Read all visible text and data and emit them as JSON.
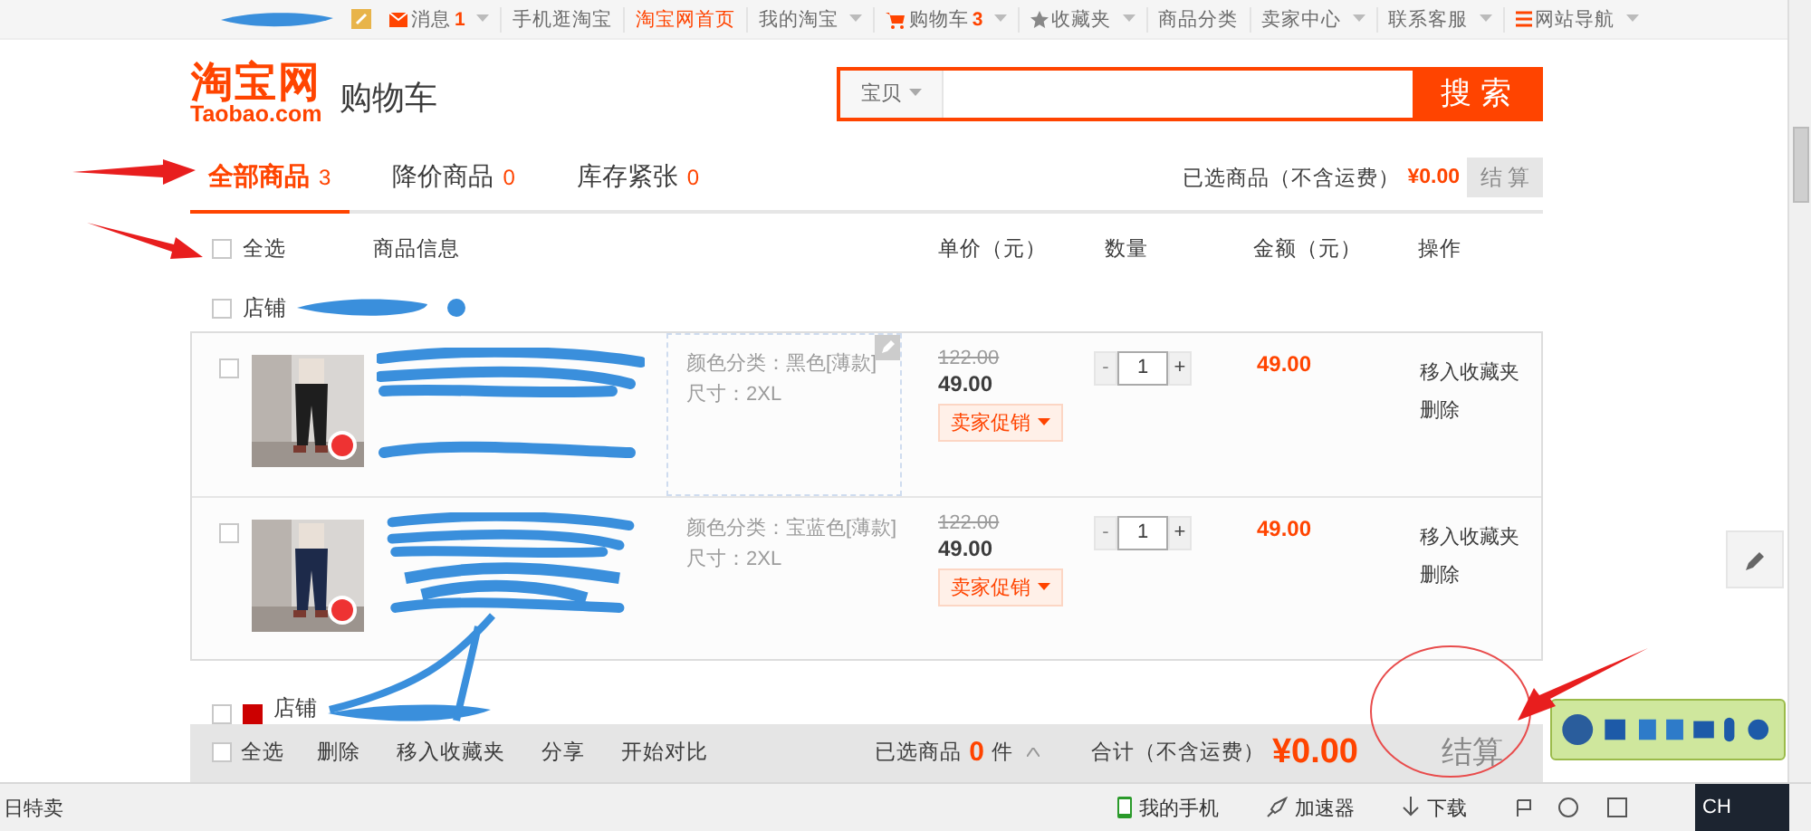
{
  "top_nav": {
    "items": [
      {
        "label": "消息",
        "count": "1",
        "kind": "mail",
        "dropdown": true,
        "active": false
      },
      {
        "label": "手机逛淘宝",
        "dropdown": false,
        "active": false
      },
      {
        "label": "淘宝网首页",
        "dropdown": false,
        "active": true
      },
      {
        "label": "我的淘宝",
        "dropdown": true,
        "active": false
      },
      {
        "label": "购物车",
        "count": "3",
        "kind": "cart",
        "dropdown": true,
        "active": false
      },
      {
        "label": "收藏夹",
        "kind": "star",
        "dropdown": true,
        "active": false
      },
      {
        "label": "商品分类",
        "dropdown": false,
        "active": false
      },
      {
        "label": "卖家中心",
        "dropdown": true,
        "active": false
      },
      {
        "label": "联系客服",
        "dropdown": true,
        "active": false
      },
      {
        "label": "网站导航",
        "kind": "list",
        "dropdown": true,
        "active": false
      }
    ]
  },
  "header": {
    "logo": "淘宝网",
    "logo_sub": "Taobao.com",
    "title": "购物车",
    "search": {
      "scope": "宝贝",
      "button": "搜 索"
    }
  },
  "tabs": [
    {
      "label": "全部商品",
      "count": "3",
      "selected": true
    },
    {
      "label": "降价商品",
      "count": "0",
      "selected": false
    },
    {
      "label": "库存紧张",
      "count": "0",
      "selected": false
    }
  ],
  "summary": {
    "label": "已选商品（不含运费）",
    "amount": "¥0.00",
    "checkout": "结 算",
    "checkout_disabled": true
  },
  "columns": [
    "全选",
    "商品信息",
    "单价（元）",
    "数量",
    "金额（元）",
    "操作"
  ],
  "select_all_checked": false,
  "stores": [
    {
      "label": "店铺",
      "checked": false,
      "items": [
        {
          "checked": false,
          "sku": [
            "颜色分类：黑色[薄款]",
            "尺寸：2XL"
          ],
          "sku_hover": true,
          "original_price": "122.00",
          "price": "49.00",
          "promo": "卖家促销",
          "minus": "-",
          "quantity": "1",
          "plus": "+",
          "total": "49.00",
          "actions": [
            "移入收藏夹",
            "删除"
          ]
        },
        {
          "checked": false,
          "sku": [
            "颜色分类：宝蓝色[薄款]",
            "尺寸：2XL"
          ],
          "sku_hover": false,
          "original_price": "122.00",
          "price": "49.00",
          "promo": "卖家促销",
          "minus": "-",
          "quantity": "1",
          "plus": "+",
          "total": "49.00",
          "actions": [
            "移入收藏夹",
            "删除"
          ]
        }
      ]
    },
    {
      "label": "店铺",
      "checked": false
    }
  ],
  "footer_bar": {
    "select_all": "全选",
    "select_all_checked": false,
    "actions": [
      "删除",
      "移入收藏夹",
      "分享",
      "开始对比"
    ],
    "selected_label": "已选商品",
    "selected_count": "0",
    "unit": "件",
    "total_label": "合计（不含运费）",
    "total": "¥0.00",
    "checkout": "结算"
  },
  "status_bar": {
    "left": "日特卖",
    "items": [
      {
        "label": "我的手机",
        "kind": "phone"
      },
      {
        "label": "加速器",
        "kind": "rocket"
      },
      {
        "label": "下载",
        "kind": "download"
      }
    ],
    "ime": "CH"
  }
}
